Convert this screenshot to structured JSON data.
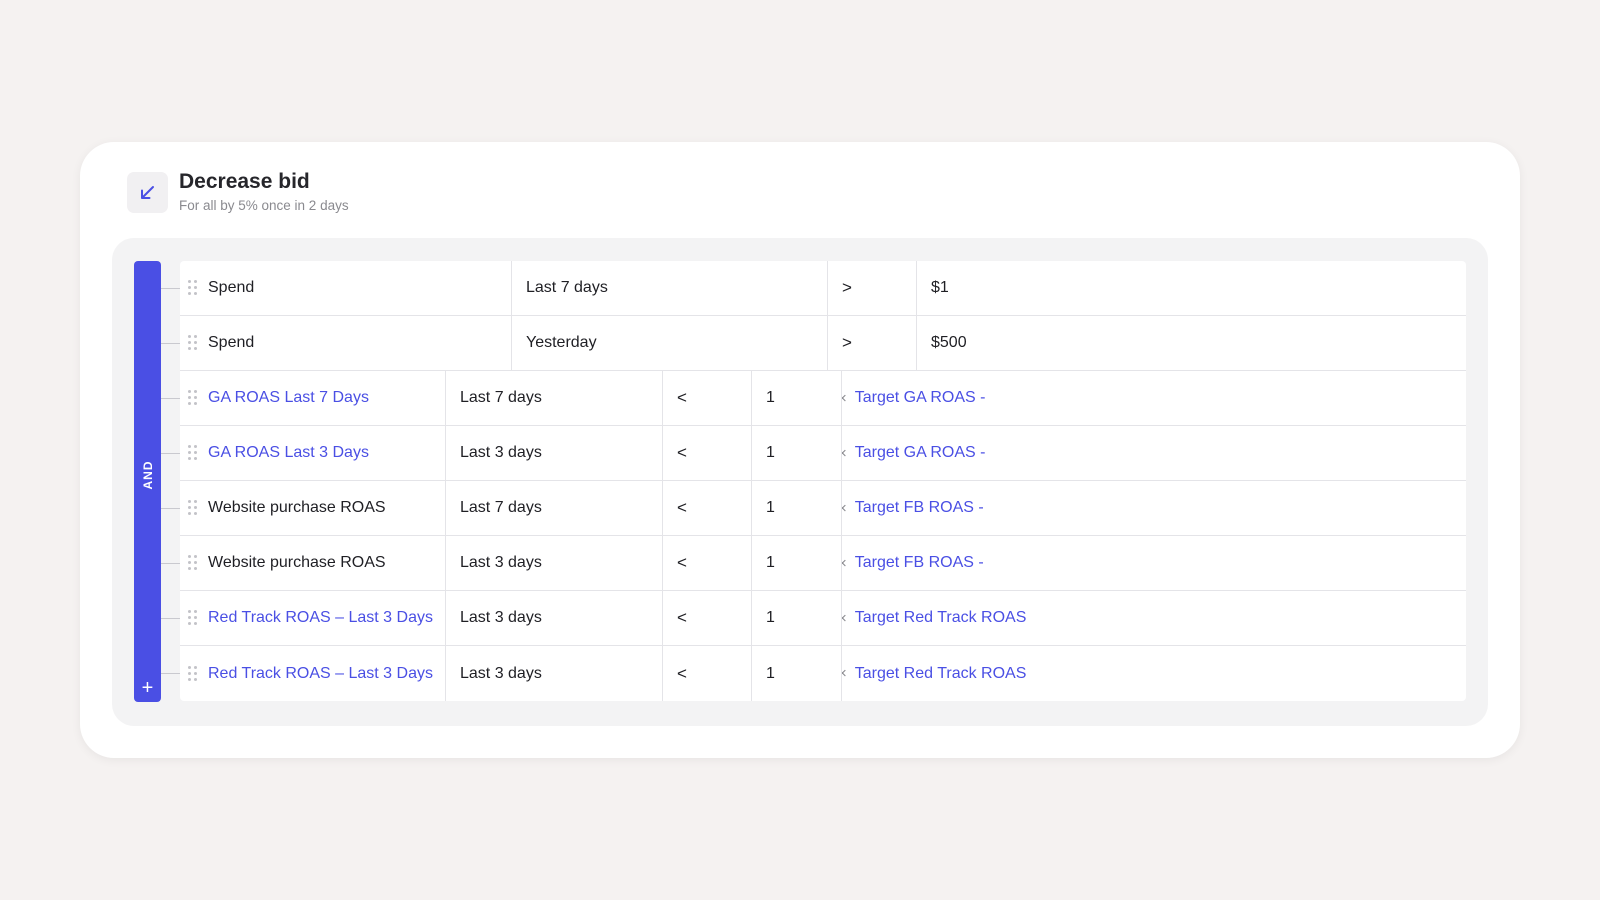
{
  "header": {
    "title": "Decrease bid",
    "subtitle": "For all by 5% once in 2 days",
    "icon": "arrow-down-left-icon"
  },
  "condition_group": {
    "operator_label": "AND",
    "add_label": "+"
  },
  "colors": {
    "accent": "#4a4fe4",
    "background": "#f5f2f1",
    "panel": "#f3f3f4"
  },
  "rules": [
    {
      "metric": "Spend",
      "metric_link": false,
      "period": "Last 7 days",
      "operator": ">",
      "value": "$1",
      "rhs": ""
    },
    {
      "metric": "Spend",
      "metric_link": false,
      "period": "Yesterday",
      "operator": ">",
      "value": "$500",
      "rhs": ""
    },
    {
      "metric": "GA ROAS Last 7 Days",
      "metric_link": true,
      "period": "Last 7 days",
      "operator": "<",
      "value": "1",
      "multiply": "×",
      "rhs": "Target GA ROAS -"
    },
    {
      "metric": "GA ROAS Last 3 Days",
      "metric_link": true,
      "period": "Last 3 days",
      "operator": "<",
      "value": "1",
      "multiply": "×",
      "rhs": "Target GA ROAS -"
    },
    {
      "metric": "Website purchase ROAS",
      "metric_link": false,
      "period": "Last 7 days",
      "operator": "<",
      "value": "1",
      "multiply": "×",
      "rhs": "Target FB ROAS -"
    },
    {
      "metric": "Website purchase ROAS",
      "metric_link": false,
      "period": "Last 3 days",
      "operator": "<",
      "value": "1",
      "multiply": "×",
      "rhs": "Target FB ROAS -"
    },
    {
      "metric": "Red Track ROAS – Last 3 Days",
      "metric_link": true,
      "period": "Last 3 days",
      "operator": "<",
      "value": "1",
      "multiply": "×",
      "rhs": "Target Red Track ROAS"
    },
    {
      "metric": "Red Track ROAS – Last 3 Days",
      "metric_link": true,
      "period": "Last 3 days",
      "operator": "<",
      "value": "1",
      "multiply": "×",
      "rhs": "Target Red Track ROAS"
    }
  ]
}
